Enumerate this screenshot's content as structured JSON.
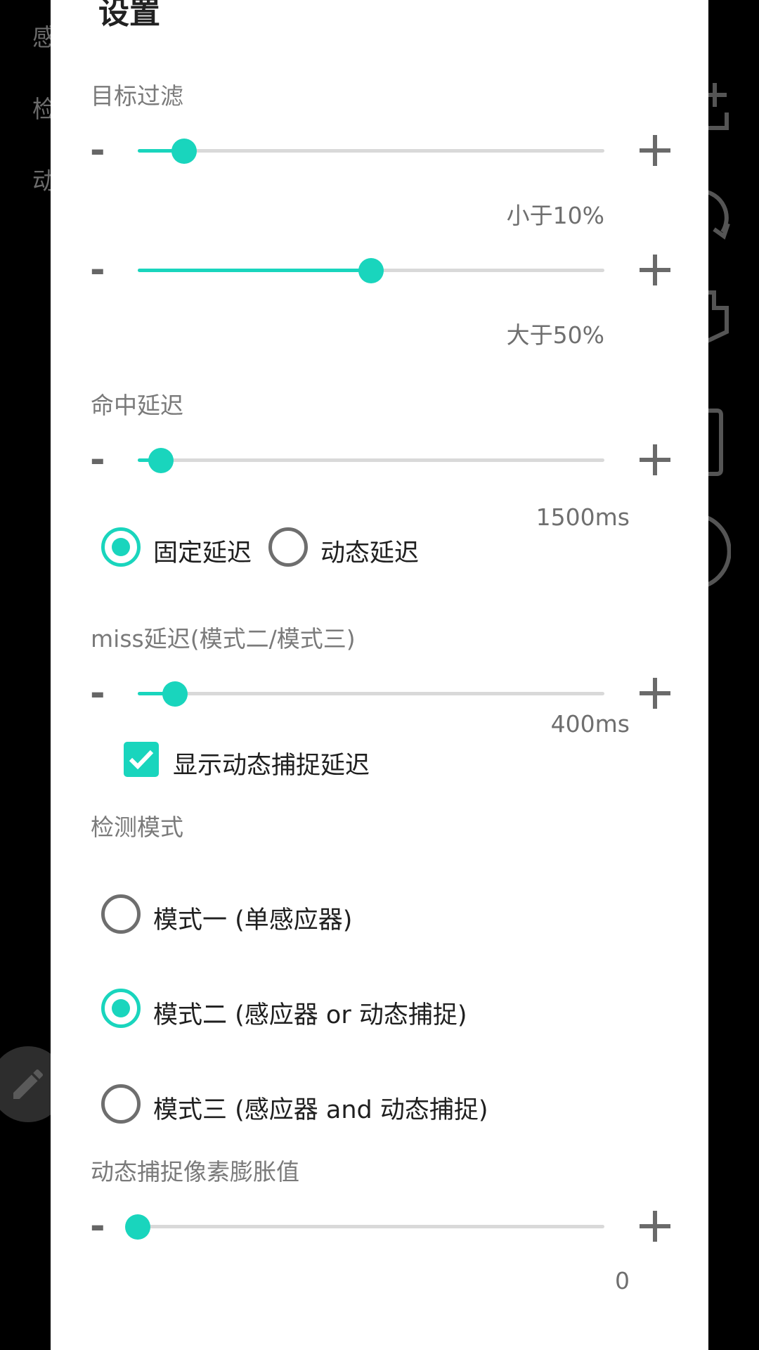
{
  "background": {
    "labels": [
      "感",
      "检",
      "动"
    ]
  },
  "dialog": {
    "title": "设置",
    "sections": {
      "target_filter": {
        "title": "目标过滤",
        "slider_min": {
          "value_text": "小于10%",
          "fraction": 0.1
        },
        "slider_max": {
          "value_text": "大于50%",
          "fraction": 0.5
        }
      },
      "hit_delay": {
        "title": "命中延迟",
        "slider": {
          "value_text": "1500ms",
          "fraction": 0.05
        },
        "radio_fixed": "固定延迟",
        "radio_dynamic": "动态延迟",
        "selected": "fixed"
      },
      "miss_delay": {
        "title": "miss延迟(模式二/模式三)",
        "slider": {
          "value_text": "400ms",
          "fraction": 0.08
        },
        "checkbox_label": "显示动态捕捉延迟",
        "checkbox_checked": true
      },
      "detect_mode": {
        "title": "检测模式",
        "modes": [
          {
            "label": "模式一 (单感应器)",
            "checked": false
          },
          {
            "label": "模式二 (感应器 or 动态捕捉)",
            "checked": true
          },
          {
            "label": "模式三 (感应器 and 动态捕捉)",
            "checked": false
          }
        ]
      },
      "dilation": {
        "title": "动态捕捉像素膨胀值",
        "slider": {
          "value_text": "0",
          "fraction": 0.0
        }
      }
    },
    "controls": {
      "minus": "-"
    }
  },
  "colors": {
    "accent": "#19d5bd",
    "dialog_bg": "#ffffff",
    "scrim": "#000000"
  },
  "icons": [
    "edit-icon",
    "add-icon",
    "refresh-icon",
    "phone-icon",
    "frame-icon",
    "circle-icon"
  ]
}
